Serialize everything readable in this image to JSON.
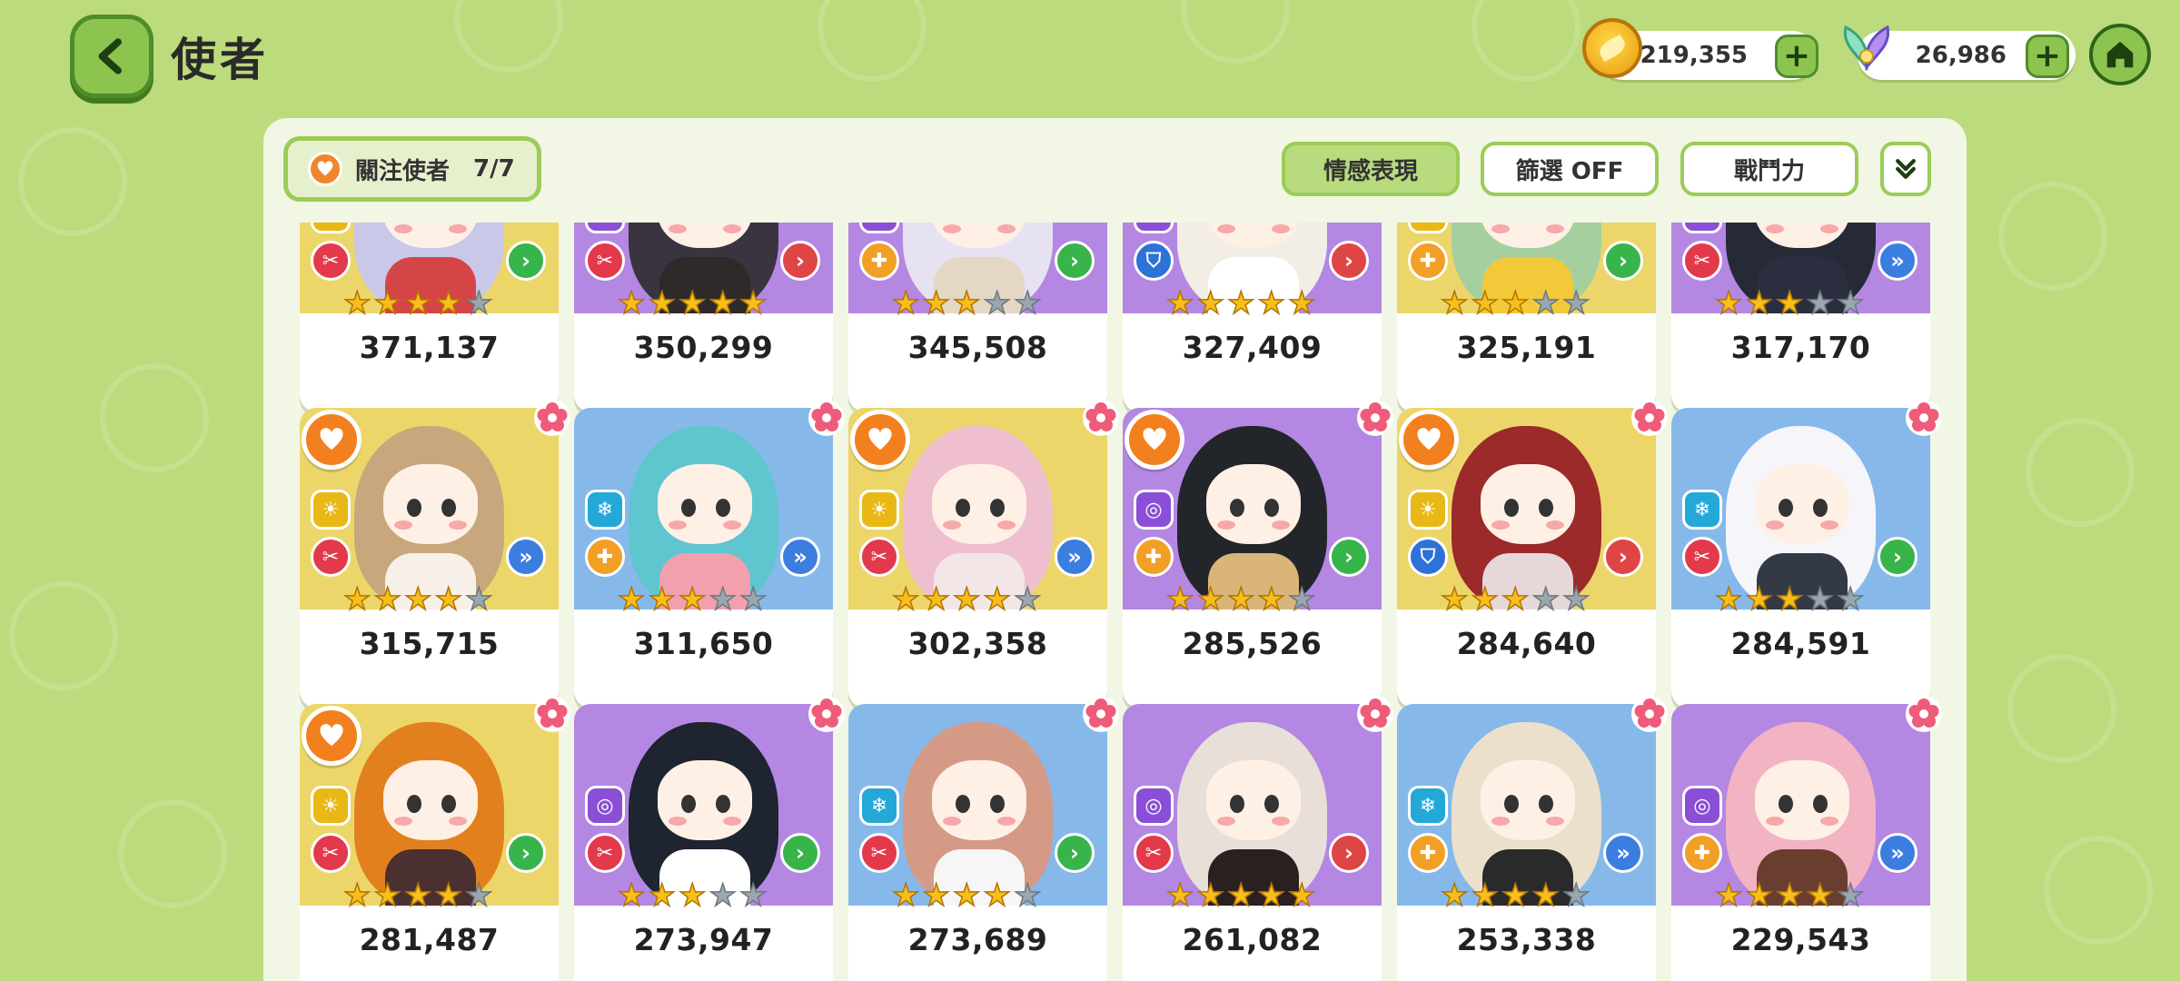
{
  "header": {
    "title": "使者",
    "gold_amount": "219,355",
    "gem_amount": "26,986"
  },
  "toolbar": {
    "favorites_label": "關注使者",
    "favorites_count": "7/7",
    "filter_expression": "情感表現",
    "filter_toggle": "篩選 OFF",
    "sort_power": "戰鬥力"
  },
  "colors": {
    "background": "#bcdb7c",
    "accent_green": "#8cc44f",
    "favorite_orange": "#f3801e"
  },
  "cards": [
    {
      "power": "371,137",
      "stars": 4,
      "bg": "yellow",
      "element": "sun",
      "role": "attack",
      "arrow": "green",
      "favorite": false,
      "hair": "#c9c8e8",
      "outfit": "#d54545"
    },
    {
      "power": "350,299",
      "stars": 5,
      "bg": "purple",
      "element": "void",
      "role": "attack",
      "arrow": "red",
      "favorite": false,
      "hair": "#3a3340",
      "outfit": "#2e2a2a"
    },
    {
      "power": "345,508",
      "stars": 3,
      "bg": "purple",
      "element": "void",
      "role": "heal",
      "arrow": "green",
      "favorite": false,
      "hair": "#e6e2f2",
      "outfit": "#e4d7c3"
    },
    {
      "power": "327,409",
      "stars": 5,
      "bg": "purple",
      "element": "void",
      "role": "tank",
      "arrow": "red",
      "favorite": false,
      "hair": "#f2ede5",
      "outfit": "#ffffff"
    },
    {
      "power": "325,191",
      "stars": 3,
      "bg": "yellow",
      "element": "sun",
      "role": "heal",
      "arrow": "green",
      "favorite": false,
      "hair": "#a6cfa0",
      "outfit": "#f3c93a"
    },
    {
      "power": "317,170",
      "stars": 3,
      "bg": "purple",
      "element": "void",
      "role": "attack",
      "arrow": "blue",
      "favorite": false,
      "hair": "#262a36",
      "outfit": "#2a2e3e"
    },
    {
      "power": "315,715",
      "stars": 4,
      "bg": "yellow",
      "element": "sun",
      "role": "attack",
      "arrow": "blue",
      "favorite": true,
      "hair": "#c8a77c",
      "outfit": "#f6f0e8"
    },
    {
      "power": "311,650",
      "stars": 3,
      "bg": "blue",
      "element": "ice",
      "role": "heal",
      "arrow": "blue",
      "favorite": false,
      "hair": "#5fc5cf",
      "outfit": "#f2a0ad"
    },
    {
      "power": "302,358",
      "stars": 4,
      "bg": "yellow",
      "element": "sun",
      "role": "attack",
      "arrow": "blue",
      "favorite": true,
      "hair": "#f0bfcf",
      "outfit": "#f2e6e6"
    },
    {
      "power": "285,526",
      "stars": 4,
      "bg": "purple",
      "element": "void",
      "role": "heal",
      "arrow": "green",
      "favorite": true,
      "hair": "#22262a",
      "outfit": "#d9b57a"
    },
    {
      "power": "284,640",
      "stars": 3,
      "bg": "yellow",
      "element": "sun",
      "role": "tank",
      "arrow": "red",
      "favorite": true,
      "hair": "#9c2a2a",
      "outfit": "#e6d8d8"
    },
    {
      "power": "284,591",
      "stars": 3,
      "bg": "blue",
      "element": "ice",
      "role": "attack",
      "arrow": "green",
      "favorite": false,
      "hair": "#f6f6fa",
      "outfit": "#333a46"
    },
    {
      "power": "281,487",
      "stars": 4,
      "bg": "yellow",
      "element": "sun",
      "role": "attack",
      "arrow": "green",
      "favorite": true,
      "hair": "#e3801e",
      "outfit": "#4a3030"
    },
    {
      "power": "273,947",
      "stars": 3,
      "bg": "purple",
      "element": "void",
      "role": "attack",
      "arrow": "green",
      "favorite": false,
      "hair": "#1e2430",
      "outfit": "#ffffff"
    },
    {
      "power": "273,689",
      "stars": 4,
      "bg": "blue",
      "element": "ice",
      "role": "attack",
      "arrow": "green",
      "favorite": false,
      "hair": "#d59a86",
      "outfit": "#f6f6f6"
    },
    {
      "power": "261,082",
      "stars": 5,
      "bg": "purple",
      "element": "void",
      "role": "attack",
      "arrow": "red",
      "favorite": false,
      "hair": "#e8e0d8",
      "outfit": "#2a2020"
    },
    {
      "power": "253,338",
      "stars": 4,
      "bg": "blue",
      "element": "ice",
      "role": "heal",
      "arrow": "blue",
      "favorite": false,
      "hair": "#ece0cc",
      "outfit": "#2a2a2a"
    },
    {
      "power": "229,543",
      "stars": 4,
      "bg": "purple",
      "element": "void",
      "role": "heal",
      "arrow": "blue",
      "favorite": false,
      "hair": "#f2b3c2",
      "outfit": "#6a3e2e"
    }
  ]
}
